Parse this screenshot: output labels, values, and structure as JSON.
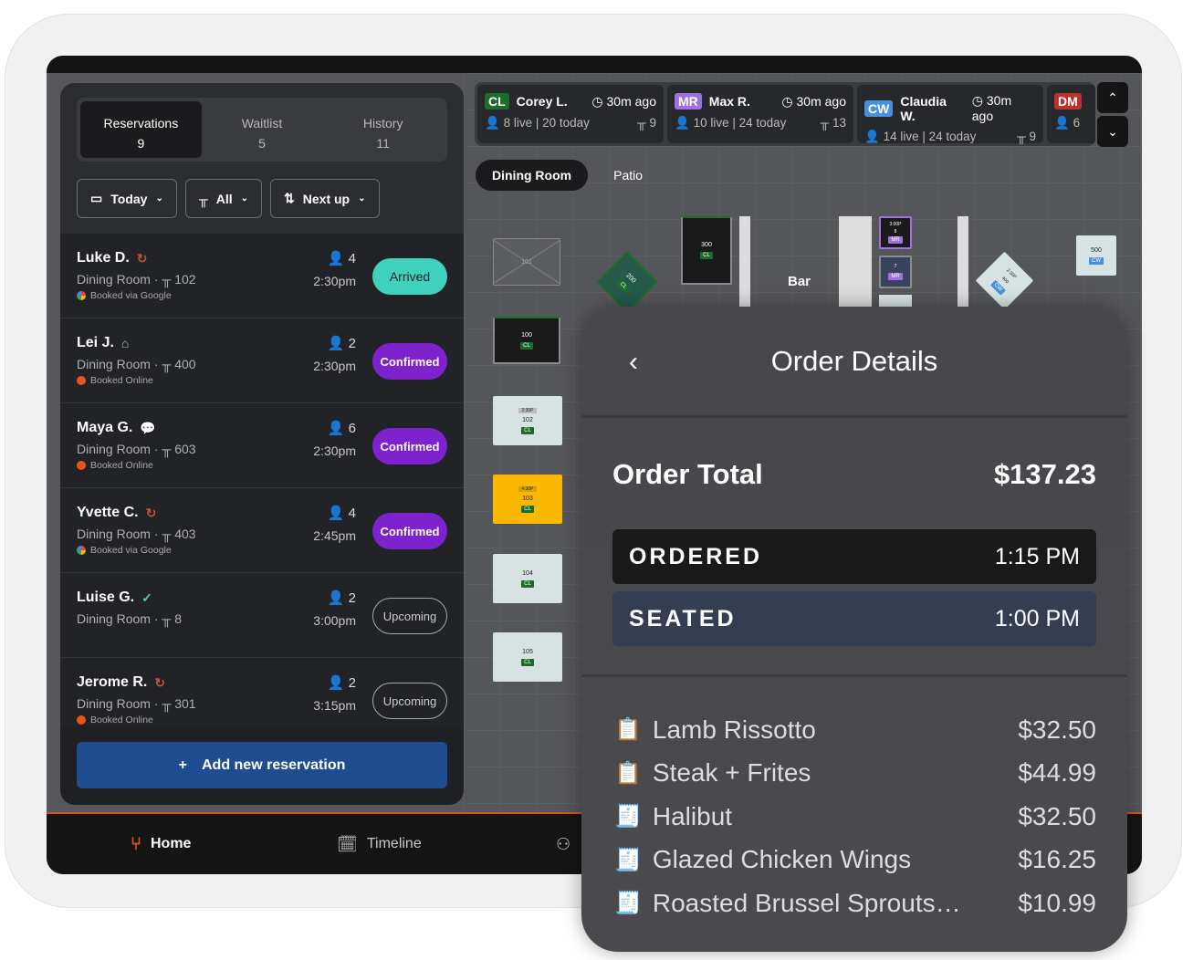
{
  "tabs": [
    {
      "label": "Reservations",
      "count": "9"
    },
    {
      "label": "Waitlist",
      "count": "5"
    },
    {
      "label": "History",
      "count": "11"
    }
  ],
  "filters": [
    {
      "label": "Today",
      "icon": "calendar-icon"
    },
    {
      "label": "All",
      "icon": "table-icon"
    },
    {
      "label": "Next up",
      "icon": "sort-icon"
    }
  ],
  "reservations": [
    {
      "name": "Luke D.",
      "icon": "recurring-icon",
      "room": "Dining Room ·",
      "table": "102",
      "party": "4",
      "time": "2:30pm",
      "source": "Booked via Google",
      "status": "Arrived"
    },
    {
      "name": "Lei J.",
      "icon": "birthday-cake-icon",
      "room": "Dining Room ·",
      "table": "400",
      "party": "2",
      "time": "2:30pm",
      "source": "Booked Online",
      "status": "Confirmed"
    },
    {
      "name": "Maya G.",
      "icon": "chat-icon",
      "room": "Dining Room ·",
      "table": "603",
      "party": "6",
      "time": "2:30pm",
      "source": "Booked Online",
      "status": "Confirmed"
    },
    {
      "name": "Yvette C.",
      "icon": "recurring-icon",
      "room": "Dining Room ·",
      "table": "403",
      "party": "4",
      "time": "2:45pm",
      "source": "Booked via Google",
      "status": "Confirmed"
    },
    {
      "name": "Luise G.",
      "icon": "verified-icon",
      "room": "Dining Room ·",
      "table": "8",
      "party": "2",
      "time": "3:00pm",
      "source": "",
      "status": "Upcoming"
    },
    {
      "name": "Jerome R.",
      "icon": "recurring-icon",
      "room": "Dining Room ·",
      "table": "301",
      "party": "2",
      "time": "3:15pm",
      "source": "Booked Online",
      "status": "Upcoming"
    }
  ],
  "add_button": "Add new reservation",
  "servers": [
    {
      "initials": "CL",
      "name": "Corey L.",
      "ago": "30m ago",
      "stats": "8 live | 20 today",
      "tables": "9",
      "color": "#1b6e2a"
    },
    {
      "initials": "MR",
      "name": "Max R.",
      "ago": "30m ago",
      "stats": "10 live | 24 today",
      "tables": "13",
      "color": "#a070e0"
    },
    {
      "initials": "CW",
      "name": "Claudia W.",
      "ago": "30m ago",
      "stats": "14 live | 24 today",
      "tables": "9",
      "color": "#4a90e2"
    },
    {
      "initials": "DM",
      "name": "",
      "ago": "",
      "stats": "6",
      "tables": "",
      "color": "#c0302a"
    }
  ],
  "rooms": [
    "Dining Room",
    "Patio"
  ],
  "floor": {
    "bar_label": "Bar",
    "tables": [
      {
        "id": "101"
      },
      {
        "id": "100",
        "server": "CL"
      },
      {
        "id": "102",
        "time": "2:30P",
        "server": "CL"
      },
      {
        "id": "103",
        "time": "4:30P",
        "server": "CL"
      },
      {
        "id": "104",
        "server": "CL"
      },
      {
        "id": "105",
        "server": "CL"
      },
      {
        "id": "200",
        "server": "CL"
      },
      {
        "id": "300",
        "server": "CL"
      },
      {
        "id": "8",
        "time": "3:00P",
        "server": "MR"
      },
      {
        "id": "7",
        "server": "MR"
      },
      {
        "id": "400",
        "time": "2:30P",
        "server": "CW"
      },
      {
        "id": "500",
        "server": "CW"
      }
    ]
  },
  "nav": [
    {
      "label": "Home",
      "icon": "dining-icon"
    },
    {
      "label": "Timeline",
      "icon": "calendar-clock-icon"
    },
    {
      "label": "",
      "icon": "guests-icon"
    }
  ],
  "order": {
    "title": "Order Details",
    "total_label": "Order Total",
    "total": "$137.23",
    "ordered_label": "ORDERED",
    "ordered_time": "1:15 PM",
    "seated_label": "SEATED",
    "seated_time": "1:00 PM",
    "items": [
      {
        "name": "Lamb Rissotto",
        "price": "$32.50",
        "state": "sent"
      },
      {
        "name": "Steak + Frites",
        "price": "$44.99",
        "state": "sent"
      },
      {
        "name": "Halibut",
        "price": "$32.50",
        "state": "done"
      },
      {
        "name": "Glazed Chicken Wings",
        "price": "$16.25",
        "state": "done"
      },
      {
        "name": "Roasted Brussel Sprouts…",
        "price": "$10.99",
        "state": "done"
      }
    ]
  },
  "colors": {
    "accent": "#d9541c",
    "arrived": "#3fd1be",
    "confirmed": "#7e22ce",
    "blue": "#1f4d92",
    "sent": "#f5b614",
    "done": "#3fd1be"
  }
}
